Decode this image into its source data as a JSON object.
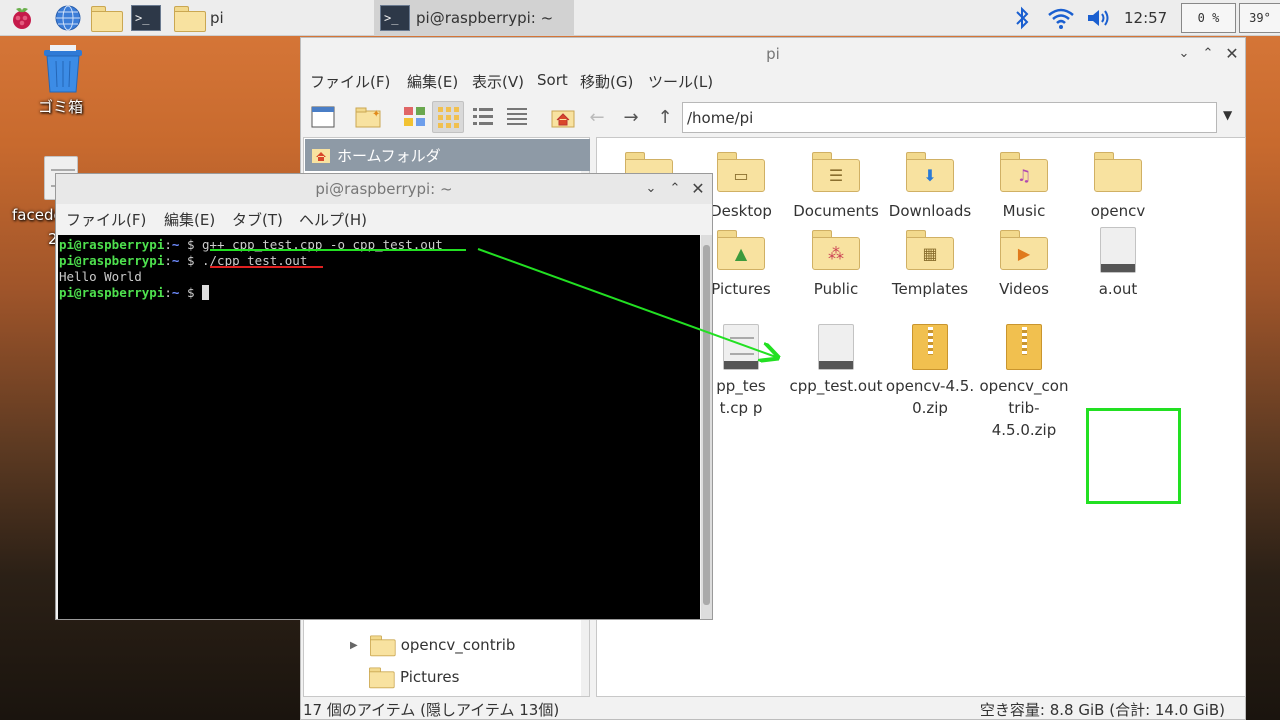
{
  "taskbar": {
    "tasks": [
      {
        "label": "pi"
      },
      {
        "label": "pi@raspberrypi: ~"
      }
    ],
    "terminal_glyph": ">_",
    "clock": "12:57",
    "cpu": "0 %",
    "temp": "39°"
  },
  "desktop": {
    "trash_label": "ゴミ箱",
    "file_label_partial": "facede",
    "file_label_partial2": "2"
  },
  "file_manager": {
    "title": "pi",
    "menu": [
      "ファイル(F)",
      "編集(E)",
      "表示(V)",
      "Sort",
      "移動(G)",
      "ツール(L)"
    ],
    "path": "/home/pi",
    "sidebar": {
      "header": "ホームフォルダ",
      "rows": [
        "opencv_contrib",
        "Pictures"
      ]
    },
    "files": [
      {
        "name": "Desktop",
        "icon": "desktop-folder-icon"
      },
      {
        "name": "Documents",
        "icon": "documents-folder-icon"
      },
      {
        "name": "Downloads",
        "icon": "downloads-folder-icon"
      },
      {
        "name": "Music",
        "icon": "music-folder-icon"
      },
      {
        "name": "opencv",
        "icon": "folder-icon"
      },
      {
        "name": "Pictures",
        "icon": "pictures-folder-icon"
      },
      {
        "name": "Public",
        "icon": "public-folder-icon"
      },
      {
        "name": "Templates",
        "icon": "templates-folder-icon"
      },
      {
        "name": "Videos",
        "icon": "videos-folder-icon"
      },
      {
        "name": "a.out",
        "icon": "executable-file-icon"
      },
      {
        "name": "pp_test.cp p",
        "icon": "source-file-icon"
      },
      {
        "name": "cpp_test.out",
        "icon": "executable-file-icon"
      },
      {
        "name": "opencv-4.5.0.zip",
        "line1": "opencv-4.5.",
        "line2": "0.zip",
        "icon": "zip-file-icon"
      },
      {
        "name": "opencv_contrib-4.5.0.zip",
        "line1": "opencv_con",
        "line2": "trib-4.5.0.zip",
        "icon": "zip-file-icon"
      }
    ],
    "status_left": "17 個のアイテム (隠しアイテム 13個)",
    "status_right": "空き容量: 8.8 GiB (合計: 14.0 GiB)"
  },
  "terminal": {
    "title": "pi@raspberrypi: ~",
    "menu": [
      "ファイル(F)",
      "編集(E)",
      "タブ(T)",
      "ヘルプ(H)"
    ],
    "prompt_user": "pi@raspberrypi",
    "prompt_sep": ":",
    "prompt_dir": "~",
    "prompt_sym": " $ ",
    "cmd1": "g++ cpp_test.cpp -o cpp_test.out",
    "cmd2": "./cpp_test.out",
    "output": "Hello World"
  },
  "colors": {
    "highlight_green": "#22e022",
    "underline_red": "#e02020",
    "prompt_green": "#4ee04e",
    "prompt_blue": "#6f8cff"
  }
}
